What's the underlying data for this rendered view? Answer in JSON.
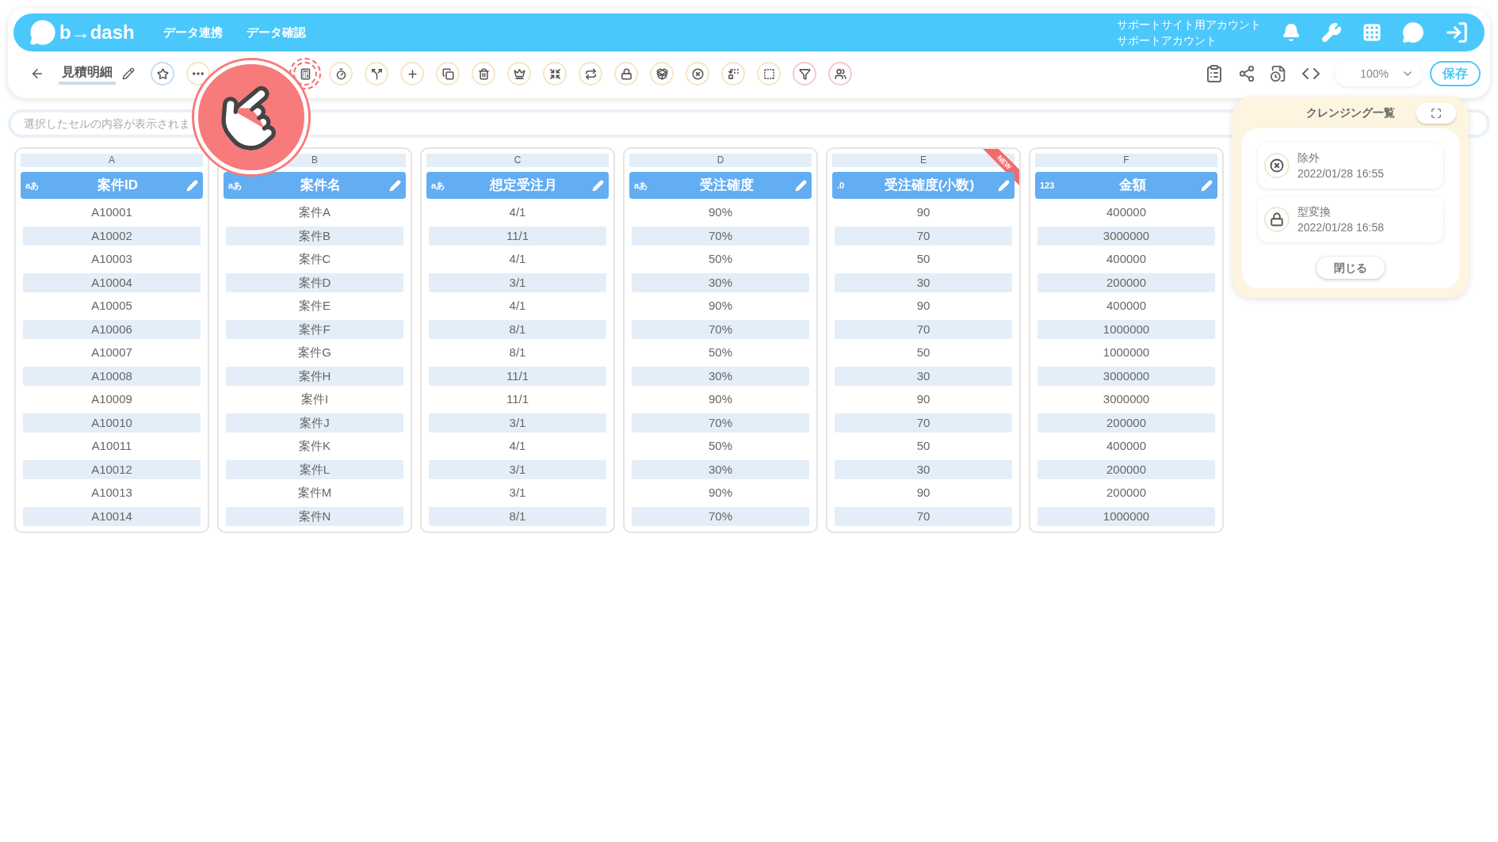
{
  "header": {
    "logo": "b→dash",
    "nav": [
      "データ連携",
      "データ確認"
    ],
    "account": [
      "サポートサイト用アカウント",
      "サポートアカウント"
    ]
  },
  "toolbar": {
    "sheet_name": "見積明細",
    "buttons": [
      {
        "kind": "star",
        "highlighted": false
      },
      {
        "kind": "more",
        "highlighted": false
      },
      {
        "kind": "calc",
        "highlighted": true
      },
      {
        "kind": "timer",
        "highlighted": false
      },
      {
        "kind": "split",
        "highlighted": false
      },
      {
        "kind": "plus",
        "highlighted": false
      },
      {
        "kind": "copy",
        "highlighted": false
      },
      {
        "kind": "trash",
        "highlighted": false
      },
      {
        "kind": "crown",
        "highlighted": false
      },
      {
        "kind": "shrink",
        "highlighted": false
      },
      {
        "kind": "repeat",
        "highlighted": false
      },
      {
        "kind": "convert",
        "highlighted": false
      },
      {
        "kind": "box",
        "highlighted": false
      },
      {
        "kind": "exclude",
        "highlighted": false
      },
      {
        "kind": "replace",
        "highlighted": false
      },
      {
        "kind": "zero",
        "highlighted": false
      },
      {
        "kind": "filter",
        "highlighted": false
      },
      {
        "kind": "group",
        "highlighted": false
      }
    ],
    "zoom": "100%",
    "save": "保存"
  },
  "cell_field": {
    "placeholder": "選択したセルの内容が表示されま"
  },
  "columns": [
    {
      "letter": "A",
      "type_label": "aあ",
      "name": "案件ID",
      "cells": [
        "A10001",
        "A10002",
        "A10003",
        "A10004",
        "A10005",
        "A10006",
        "A10007",
        "A10008",
        "A10009",
        "A10010",
        "A10011",
        "A10012",
        "A10013",
        "A10014"
      ]
    },
    {
      "letter": "B",
      "type_label": "aあ",
      "name": "案件名",
      "cells": [
        "案件A",
        "案件B",
        "案件C",
        "案件D",
        "案件E",
        "案件F",
        "案件G",
        "案件H",
        "案件I",
        "案件J",
        "案件K",
        "案件L",
        "案件M",
        "案件N"
      ]
    },
    {
      "letter": "C",
      "type_label": "aあ",
      "name": "想定受注月",
      "cells": [
        "4/1",
        "11/1",
        "4/1",
        "3/1",
        "4/1",
        "8/1",
        "8/1",
        "11/1",
        "11/1",
        "3/1",
        "4/1",
        "3/1",
        "3/1",
        "8/1"
      ]
    },
    {
      "letter": "D",
      "type_label": "aあ",
      "name": "受注確度",
      "cells": [
        "90%",
        "70%",
        "50%",
        "30%",
        "90%",
        "70%",
        "50%",
        "30%",
        "90%",
        "70%",
        "50%",
        "30%",
        "90%",
        "70%"
      ]
    },
    {
      "letter": "E",
      "type_label": ".0",
      "name": "受注確度(小数)",
      "badge": "NEW",
      "cells": [
        "90",
        "70",
        "50",
        "30",
        "90",
        "70",
        "50",
        "30",
        "90",
        "70",
        "50",
        "30",
        "90",
        "70"
      ]
    },
    {
      "letter": "F",
      "type_label": "123",
      "name": "金額",
      "cells": [
        "400000",
        "3000000",
        "400000",
        "200000",
        "400000",
        "1000000",
        "1000000",
        "3000000",
        "3000000",
        "200000",
        "400000",
        "200000",
        "200000",
        "1000000"
      ]
    }
  ],
  "cleansing_panel": {
    "title": "クレンジング一覧",
    "items": [
      {
        "kind": "exclude",
        "name": "除外",
        "time": "2022/01/28 16:55"
      },
      {
        "kind": "convert",
        "name": "型変換",
        "time": "2022/01/28 16:58"
      }
    ],
    "close": "閉じる"
  }
}
